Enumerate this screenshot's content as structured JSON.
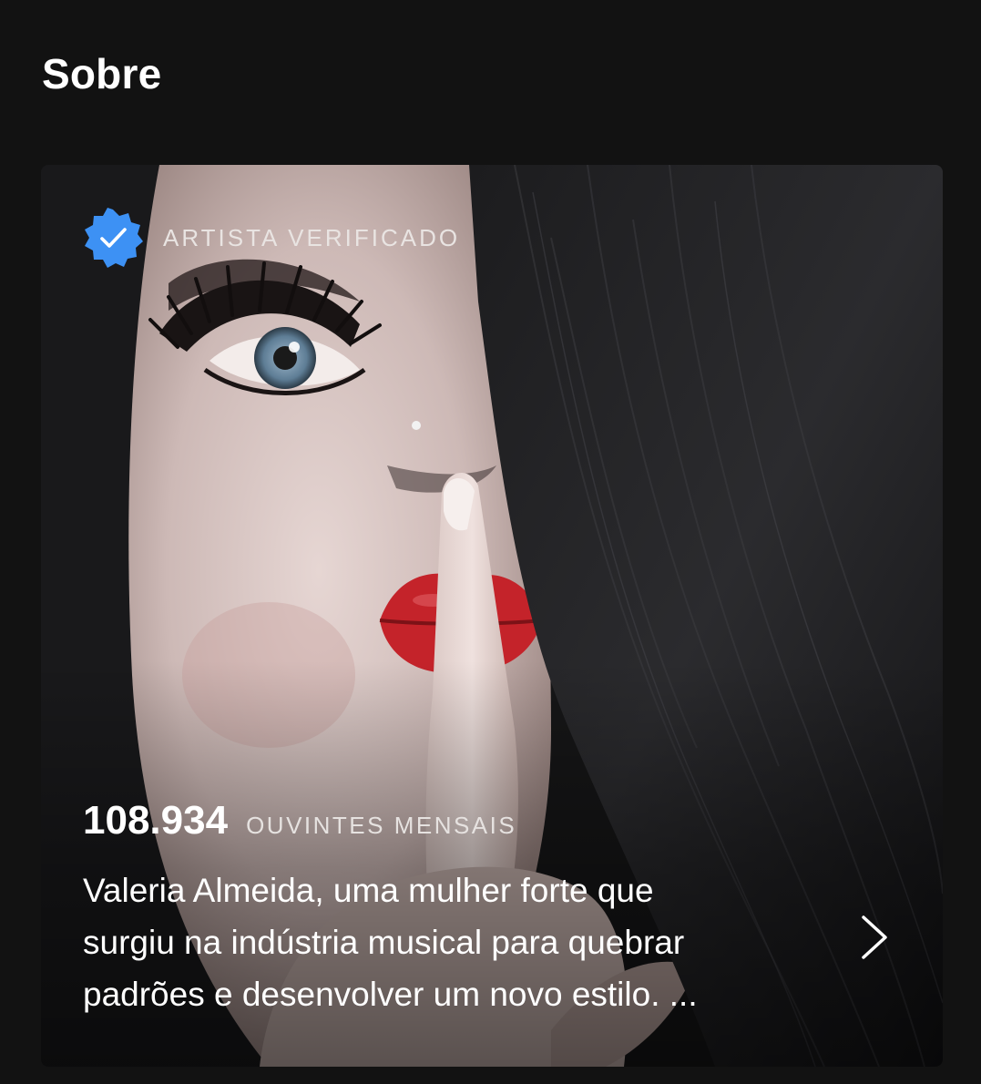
{
  "section": {
    "title": "Sobre"
  },
  "artist_card": {
    "verified_label": "ARTISTA VERIFICADO",
    "verified_icon": "verified-badge-icon",
    "verified_color": "#3d91f4",
    "monthly_listeners": "108.934",
    "monthly_listeners_label": "OUVINTES MENSAIS",
    "bio_lines": [
      "Valeria Almeida, uma mulher forte que",
      "surgiu na indústria musical para quebrar",
      "padrões e desenvolver um novo estilo. ..."
    ],
    "more_icon": "chevron-right-icon"
  }
}
